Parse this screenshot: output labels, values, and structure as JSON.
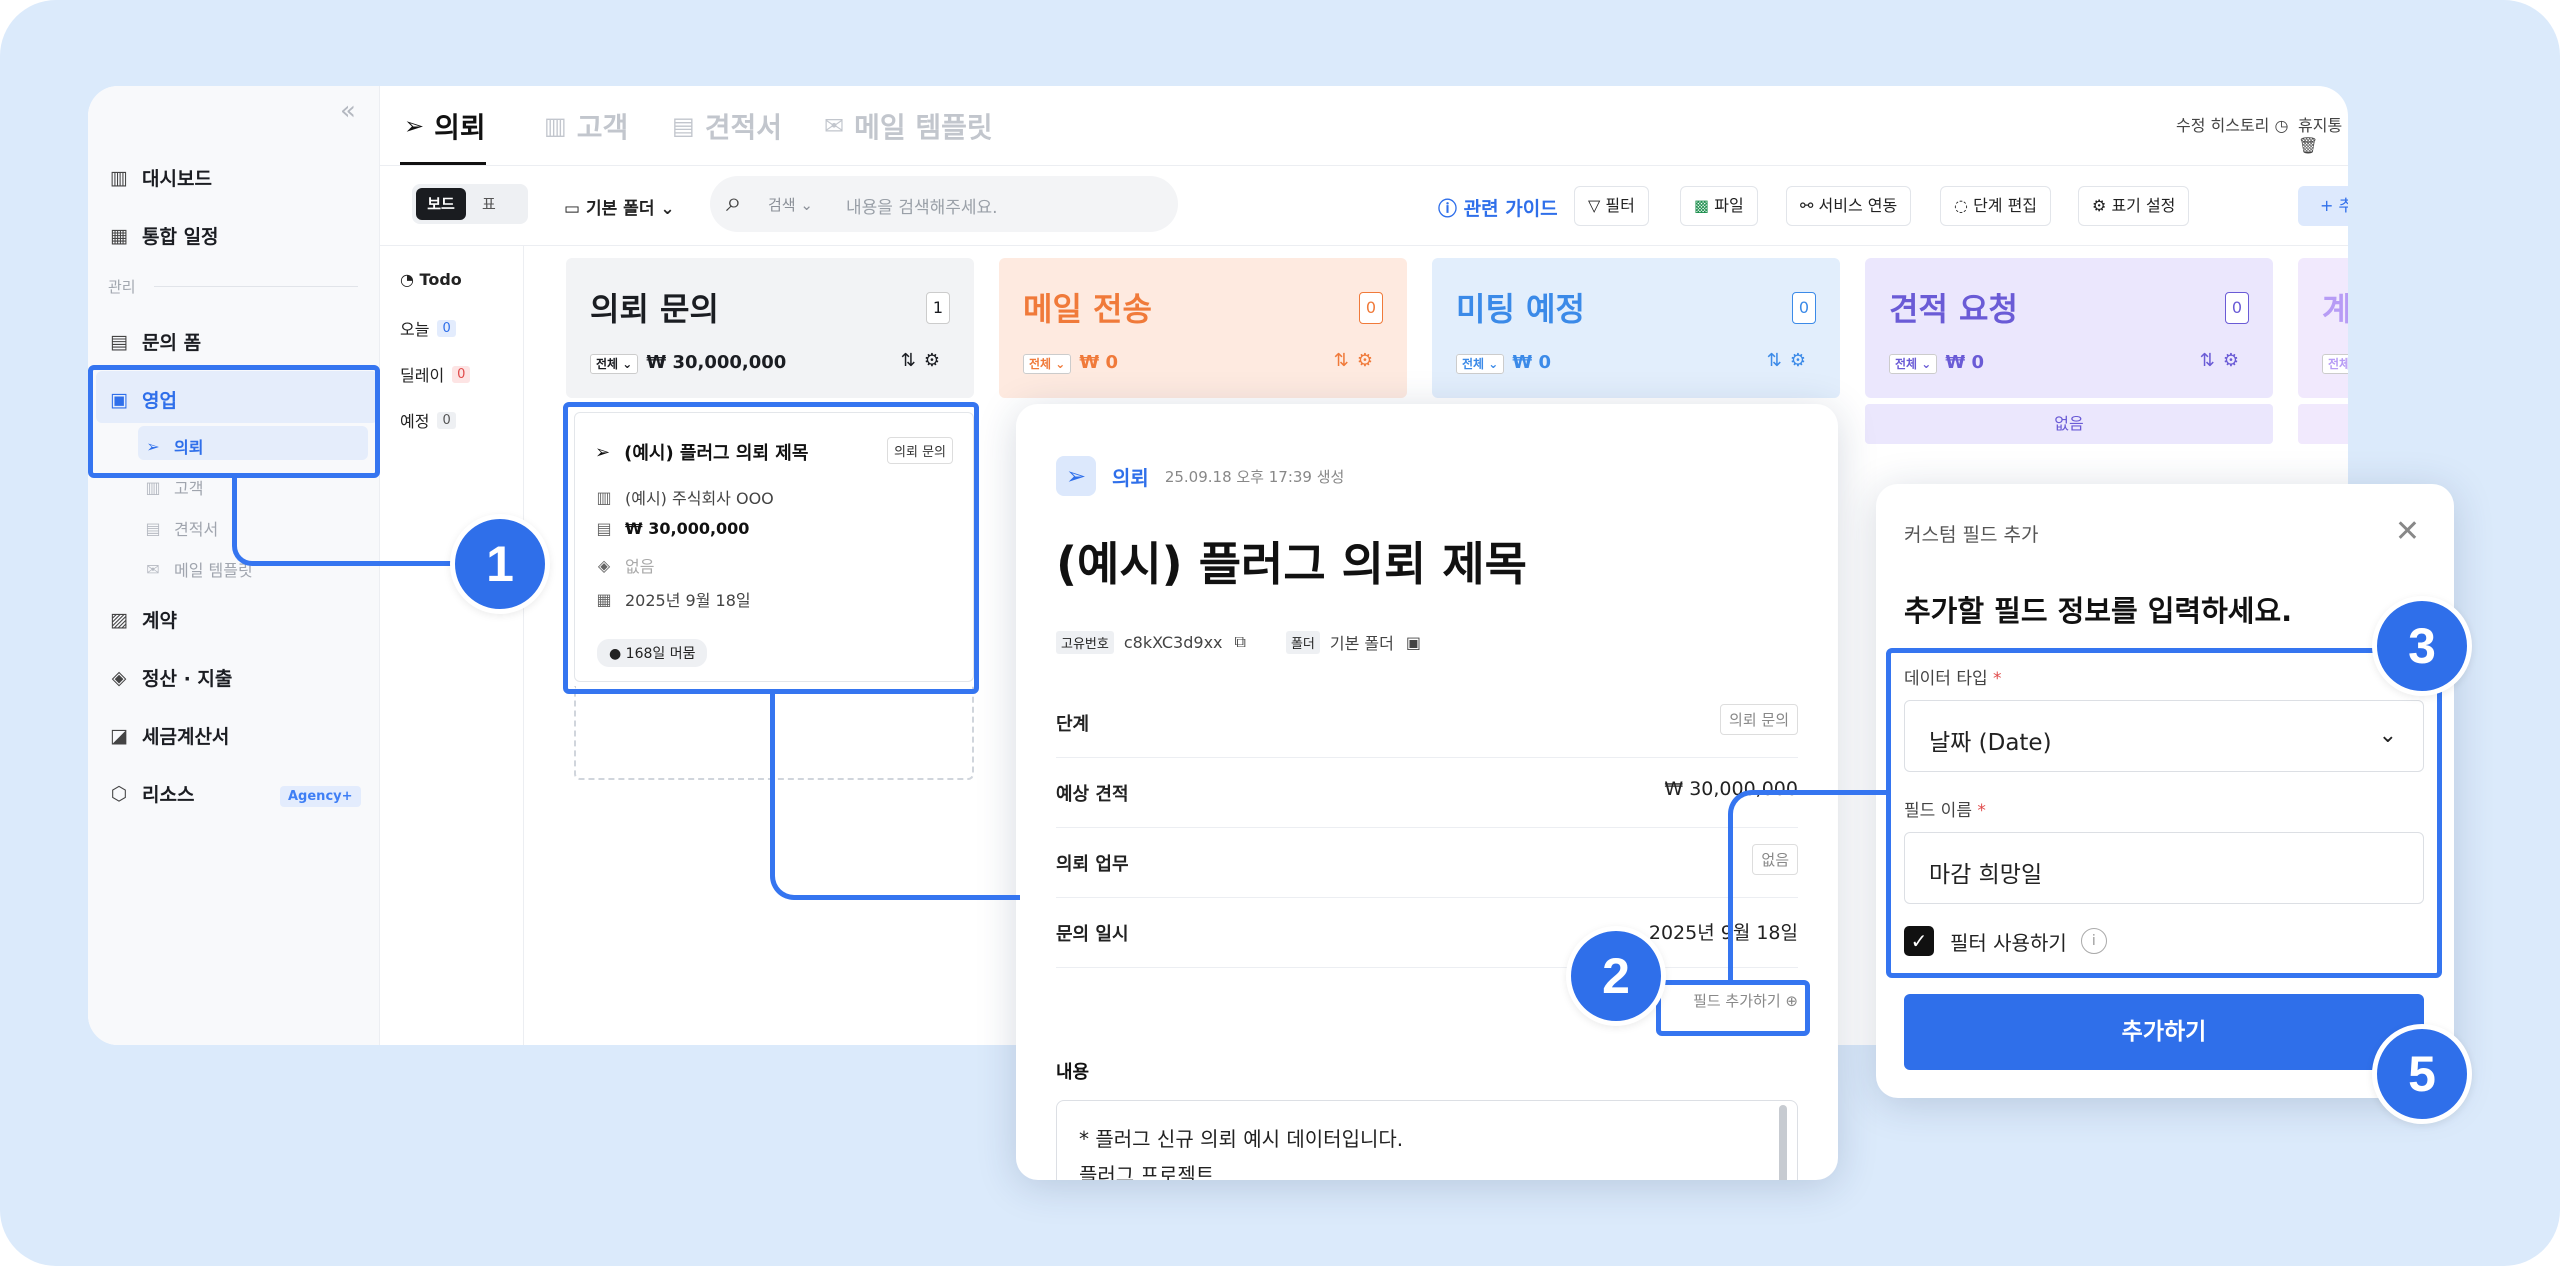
{
  "sidebar": {
    "items": [
      {
        "label": "대시보드",
        "icon": "chart-icon"
      },
      {
        "label": "통합 일정",
        "icon": "calendar-icon"
      },
      {
        "label": "문의 폼",
        "icon": "document-icon"
      },
      {
        "label": "영업",
        "icon": "briefcase-icon"
      },
      {
        "label": "계약",
        "icon": "contract-icon"
      },
      {
        "label": "정산 · 지출",
        "icon": "moneybag-icon"
      },
      {
        "label": "세금계산서",
        "icon": "tax-invoice-icon"
      },
      {
        "label": "리소스",
        "icon": "resource-icon"
      }
    ],
    "section_label": "관리",
    "sub_items": [
      {
        "label": "의뢰",
        "icon": "send-icon"
      },
      {
        "label": "고객",
        "icon": "building-icon"
      },
      {
        "label": "견적서",
        "icon": "calculator-icon"
      },
      {
        "label": "메일 템플릿",
        "icon": "mail-icon"
      }
    ],
    "agency_badge": "Agency+"
  },
  "tabs": [
    {
      "label": "의뢰",
      "icon": "send-icon"
    },
    {
      "label": "고객",
      "icon": "building-icon"
    },
    {
      "label": "견적서",
      "icon": "calculator-icon"
    },
    {
      "label": "메일 템플릿",
      "icon": "mail-icon"
    }
  ],
  "top_right": {
    "history": "수정 히스토리",
    "trash": "휴지통"
  },
  "toolbar": {
    "view_board": "보드",
    "view_table": "표",
    "folder": "기본 폴더",
    "search_scope": "검색",
    "search_placeholder": "내용을 검색해주세요.",
    "guide": "관련 가이드",
    "filter": "필터",
    "file": "파일",
    "service": "서비스 연동",
    "stage_edit": "단계 편집",
    "display_settings": "표기 설정",
    "add": "+ 추가"
  },
  "todo": {
    "title": "Todo",
    "items": [
      {
        "label": "오늘",
        "count": "0"
      },
      {
        "label": "딜레이",
        "count": "0"
      },
      {
        "label": "예정",
        "count": "0"
      }
    ]
  },
  "columns": [
    {
      "title": "의뢰 문의",
      "count": "1",
      "filter": "전체",
      "amount": "₩ 30,000,000",
      "color": "#1b1d22",
      "bg": "#f2f3f5"
    },
    {
      "title": "메일 전송",
      "count": "0",
      "filter": "전체",
      "amount": "₩ 0",
      "color": "#f07a3a",
      "bg": "#feeae0"
    },
    {
      "title": "미팅 예정",
      "count": "0",
      "filter": "전체",
      "amount": "₩ 0",
      "color": "#3b8ae8",
      "bg": "#e2eefc"
    },
    {
      "title": "견적 요청",
      "count": "0",
      "filter": "전체",
      "amount": "₩ 0",
      "color": "#6a5bd6",
      "bg": "#ebe7fd"
    },
    {
      "title": "계",
      "count": "",
      "filter": "전체",
      "amount": "",
      "color": "#b79cf5",
      "bg": "#f1e9fd"
    }
  ],
  "empty_label": "없음",
  "card": {
    "title": "(예시) 플러그 의뢰 제목",
    "tag": "의뢰 문의",
    "company": "(예시) 주식회사 OOO",
    "amount": "₩ 30,000,000",
    "none": "없음",
    "date": "2025년 9월 18일",
    "stay": "168일 머뭄"
  },
  "detail": {
    "label": "의뢰",
    "meta": "25.09.18 오후 17:39 생성",
    "title": "(예시) 플러그 의뢰 제목",
    "id_key": "고유번호",
    "id_value": "c8kXC3d9xx",
    "folder_key": "폴더",
    "folder_value": "기본 폴더",
    "rows": [
      {
        "key": "단계",
        "value": "의뢰 문의"
      },
      {
        "key": "예상 견적",
        "value": "₩ 30,000,000"
      },
      {
        "key": "의뢰 업무",
        "value": "없음"
      },
      {
        "key": "문의 일시",
        "value": "2025년 9월 18일"
      }
    ],
    "add_field": "필드 추가하기",
    "content_label": "내용",
    "content_lines": [
      "* 플러그 신규 의뢰 예시 데이터입니다.",
      "플러그 프로젝트"
    ]
  },
  "modal": {
    "title": "커스텀 필드 추가",
    "heading": "추가할 필드 정보를 입력하세요.",
    "type_label": "데이터 타입",
    "type_value": "날짜 (Date)",
    "name_label": "필드 이름",
    "name_value": "마감 희망일",
    "filter_label": "필터 사용하기",
    "submit": "추가하기",
    "required_mark": "*"
  },
  "callouts": [
    "1",
    "2",
    "3",
    "5"
  ],
  "colors": {
    "accent": "#2f6fea",
    "highlight": "#3575f0",
    "background": "#dbeafb"
  }
}
